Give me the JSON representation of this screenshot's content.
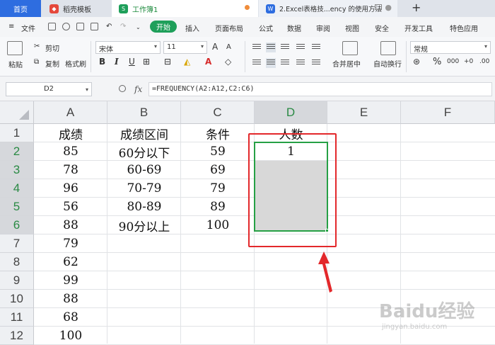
{
  "tabs": {
    "home": "首页",
    "template": "稻壳模板",
    "workbook": "工作簿1",
    "article": "2.Excel表格技...ency 的使用方法",
    "new_tab": "+"
  },
  "menu": {
    "file": "文件",
    "start": "开始",
    "insert": "插入",
    "layout": "页面布局",
    "formula": "公式",
    "data": "数据",
    "review": "审阅",
    "view": "视图",
    "security": "安全",
    "dev": "开发工具",
    "special": "特色应用"
  },
  "ribbon": {
    "cut": "剪切",
    "paste": "粘贴",
    "copy": "复制",
    "format_painter": "格式刷",
    "font_name": "宋体",
    "font_size": "11",
    "merge_center": "合并居中",
    "wrap_text": "自动换行",
    "number_format": "常规",
    "bold": "B",
    "italic": "I",
    "underline": "U",
    "grow_font": "A",
    "shrink_font": "A",
    "percent": "%"
  },
  "formula_bar": {
    "cell_ref": "D2",
    "fx": "fx",
    "formula": "=FREQUENCY(A2:A12,C2:C6)"
  },
  "grid": {
    "columns": [
      "A",
      "B",
      "C",
      "D",
      "E",
      "F"
    ],
    "rows": [
      "1",
      "2",
      "3",
      "4",
      "5",
      "6",
      "7",
      "8",
      "9",
      "10",
      "11",
      "12"
    ],
    "col_a": [
      "成绩",
      "85",
      "78",
      "96",
      "56",
      "88",
      "79",
      "62",
      "99",
      "88",
      "68",
      "100"
    ],
    "col_b": [
      "成绩区间",
      "60分以下",
      "60-69",
      "70-79",
      "80-89",
      "90分以上"
    ],
    "col_c": [
      "条件",
      "59",
      "69",
      "79",
      "89",
      "100"
    ],
    "col_d": [
      "人数",
      "1"
    ],
    "selected_column": "D",
    "selected_rows": [
      "2",
      "3",
      "4",
      "5",
      "6"
    ],
    "selection_color": "#26a045",
    "highlight_color": "#e3282b"
  },
  "watermark": {
    "brand": "Baidu经验",
    "url": "jingyan.baidu.com"
  }
}
